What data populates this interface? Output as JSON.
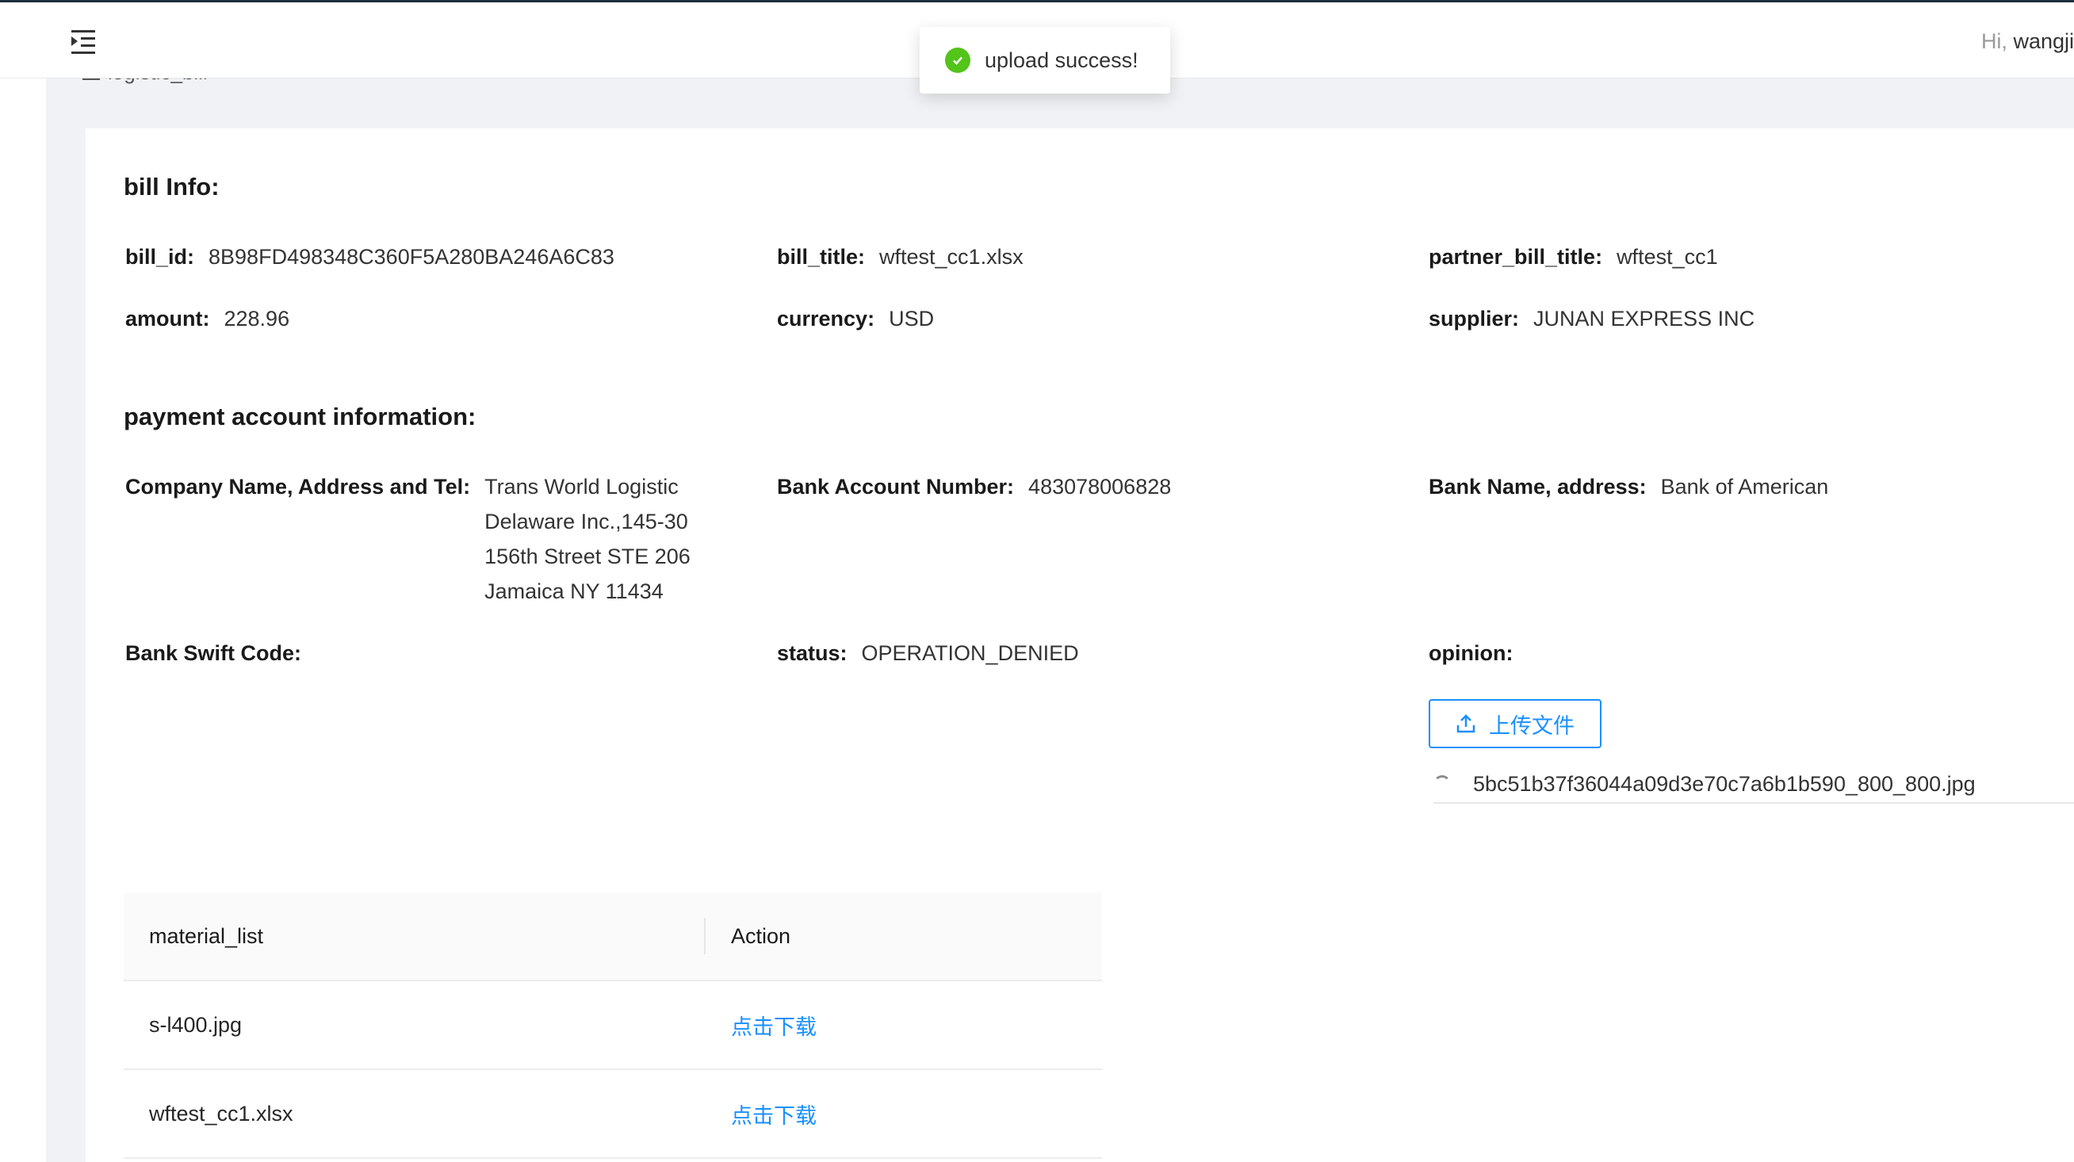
{
  "header": {
    "greeting_prefix": "Hi,",
    "username": "wangji"
  },
  "breadcrumb": {
    "label": "logistic_bill"
  },
  "toast": {
    "message": "upload success!"
  },
  "bill_info": {
    "title": "bill Info:",
    "fields": [
      {
        "label": "bill_id",
        "value": "8B98FD498348C360F5A280BA246A6C83"
      },
      {
        "label": "bill_title",
        "value": "wftest_cc1.xlsx"
      },
      {
        "label": "partner_bill_title",
        "value": "wftest_cc1"
      },
      {
        "label": "amount",
        "value": "228.96"
      },
      {
        "label": "currency",
        "value": "USD"
      },
      {
        "label": "supplier",
        "value": "JUNAN EXPRESS INC"
      }
    ]
  },
  "payment": {
    "title": "payment account information:",
    "fields": [
      {
        "label": "Company Name, Address and Tel",
        "value": "Trans World Logistic Delaware Inc.,145-30 156th Street STE 206 Jamaica NY 11434"
      },
      {
        "label": "Bank Account Number",
        "value": "483078006828"
      },
      {
        "label": "Bank Name, address",
        "value": "Bank of American"
      },
      {
        "label": "Bank Swift Code",
        "value": ""
      },
      {
        "label": "status",
        "value": "OPERATION_DENIED"
      },
      {
        "label": "opinion",
        "value": ""
      }
    ],
    "separator": ":"
  },
  "upload": {
    "button_label": "上传文件",
    "file_name": "5bc51b37f36044a09d3e70c7a6b1b590_800_800.jpg"
  },
  "materials": {
    "columns": [
      "material_list",
      "Action"
    ],
    "rows": [
      {
        "name": "s-l400.jpg",
        "action": "点击下载"
      },
      {
        "name": "wftest_cc1.xlsx",
        "action": "点击下载"
      }
    ]
  },
  "colors": {
    "primary": "#1890ff",
    "success": "#52c41a",
    "content_bg": "#f0f2f5"
  }
}
